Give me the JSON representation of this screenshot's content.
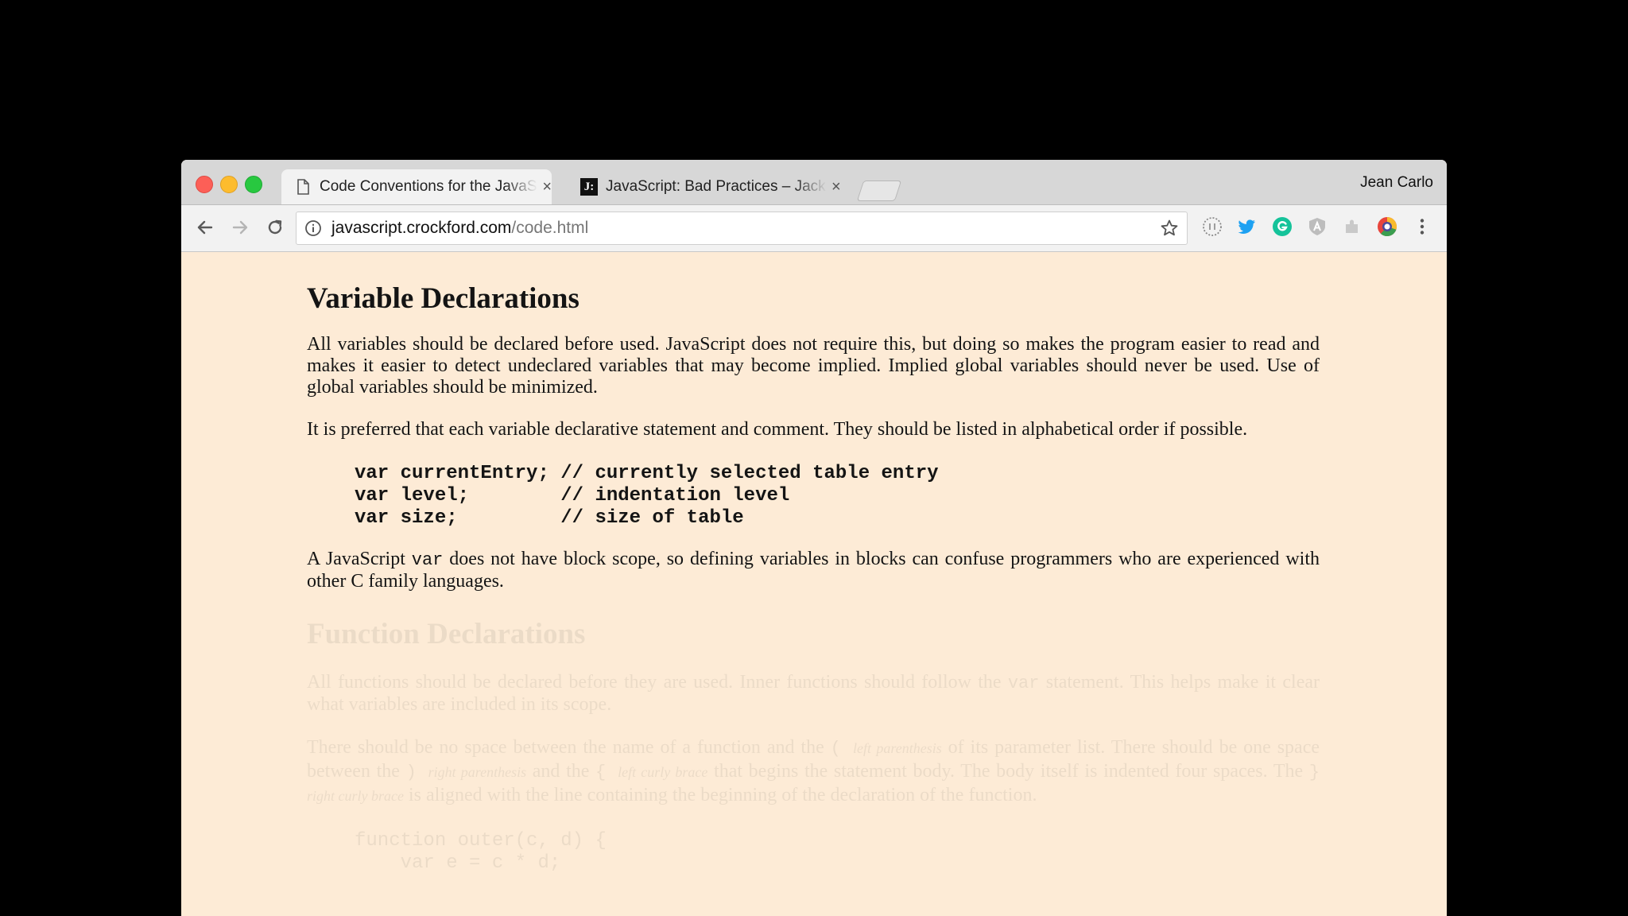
{
  "browser": {
    "tabs": [
      {
        "title": "Code Conventions for the JavaScript",
        "close": "×"
      },
      {
        "title": "JavaScript: Bad Practices – Jack",
        "close": "×",
        "favicon_text": "J:"
      }
    ],
    "user_name": "Jean Carlo",
    "url": {
      "domain": "javascript.crockford.com",
      "path": "/code.html"
    }
  },
  "page": {
    "section1": {
      "title": "Variable Declarations",
      "p1": "All variables should be declared before used. JavaScript does not require this, but doing so makes the program easier to read and makes it easier to detect undeclared variables that may become implied. Implied global variables should never be used. Use of global variables should be minimized.",
      "p2": "It is preferred that each variable declarative statement and comment. They should be listed in alphabetical order if possible.",
      "code": "var currentEntry; // currently selected table entry\nvar level;        // indentation level\nvar size;         // size of table",
      "p3_before": "A JavaScript ",
      "p3_code": "var",
      "p3_after": " does not have block scope, so defining variables in blocks can confuse programmers who are experienced with other C family languages."
    },
    "section2": {
      "title": "Function Declarations",
      "p1_before": "All functions should be declared before they are used. Inner functions should follow the ",
      "p1_code": "var",
      "p1_after": " statement. This helps make it clear what variables are included in its scope.",
      "p2_a": "There should be no space between the name of a function and the ",
      "p2_b": "( ",
      "p2_c": "left parenthesis",
      "p2_d": " of its parameter list. There should be one space between the ",
      "p2_e": ") ",
      "p2_f": "right parenthesis",
      "p2_g": " and the ",
      "p2_h": "{ ",
      "p2_i": "left curly brace",
      "p2_j": " that begins the statement body. The body itself is indented four spaces. The ",
      "p2_k": "} ",
      "p2_l": "right curly brace",
      "p2_m": " is aligned with the line containing the beginning of the declaration of the function.",
      "code": "function outer(c, d) {\n    var e = c * d;"
    }
  }
}
